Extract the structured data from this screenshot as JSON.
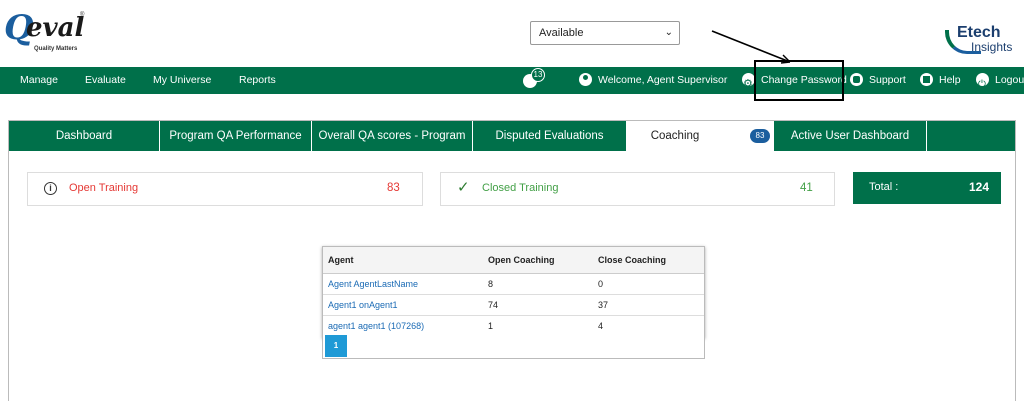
{
  "brand": {
    "logo_q": "Q",
    "logo_eval": "eval",
    "logo_tagline": "Quality Matters",
    "logo_reg": "®",
    "etech_line1": "Etech",
    "etech_line2": "Insights"
  },
  "status": {
    "selected": "Available"
  },
  "nav": {
    "manage": "Manage",
    "evaluate": "Evaluate",
    "my_universe": "My Universe",
    "reports": "Reports",
    "notification_count": "13",
    "welcome": "Welcome, Agent Supervisor",
    "change_password": "Change Password",
    "support": "Support",
    "help": "Help",
    "logout": "Logout"
  },
  "tabs": [
    {
      "label": "Dashboard"
    },
    {
      "label": "Program QA Performance"
    },
    {
      "label": "Overall QA scores - Program"
    },
    {
      "label": "Disputed Evaluations"
    },
    {
      "label": "Coaching",
      "badge": "83"
    },
    {
      "label": "Active User Dashboard"
    }
  ],
  "summary": {
    "open_label": "Open Training",
    "open_value": "83",
    "closed_label": "Closed Training",
    "closed_value": "41",
    "total_label": "Total :",
    "total_value": "124"
  },
  "table": {
    "headers": [
      "Agent",
      "Open Coaching",
      "Close Coaching"
    ],
    "rows": [
      [
        "Agent AgentLastName",
        "8",
        "0"
      ],
      [
        "Agent1 onAgent1",
        "74",
        "37"
      ],
      [
        "agent1 agent1 (107268)",
        "1",
        "4"
      ]
    ],
    "page": "1"
  },
  "colors": {
    "primary_green": "#00704a",
    "open_red": "#e53935",
    "closed_green": "#43a047",
    "link_blue": "#1b6bb5",
    "pager_blue": "#1f9ad6"
  },
  "icons": {
    "open_training": "info-circle-icon",
    "closed_training": "checkmark-icon",
    "notifications": "bell-icon",
    "user": "user-icon",
    "settings": "gear-icon",
    "support": "support-icon",
    "help": "help-icon",
    "logout": "power-icon"
  }
}
